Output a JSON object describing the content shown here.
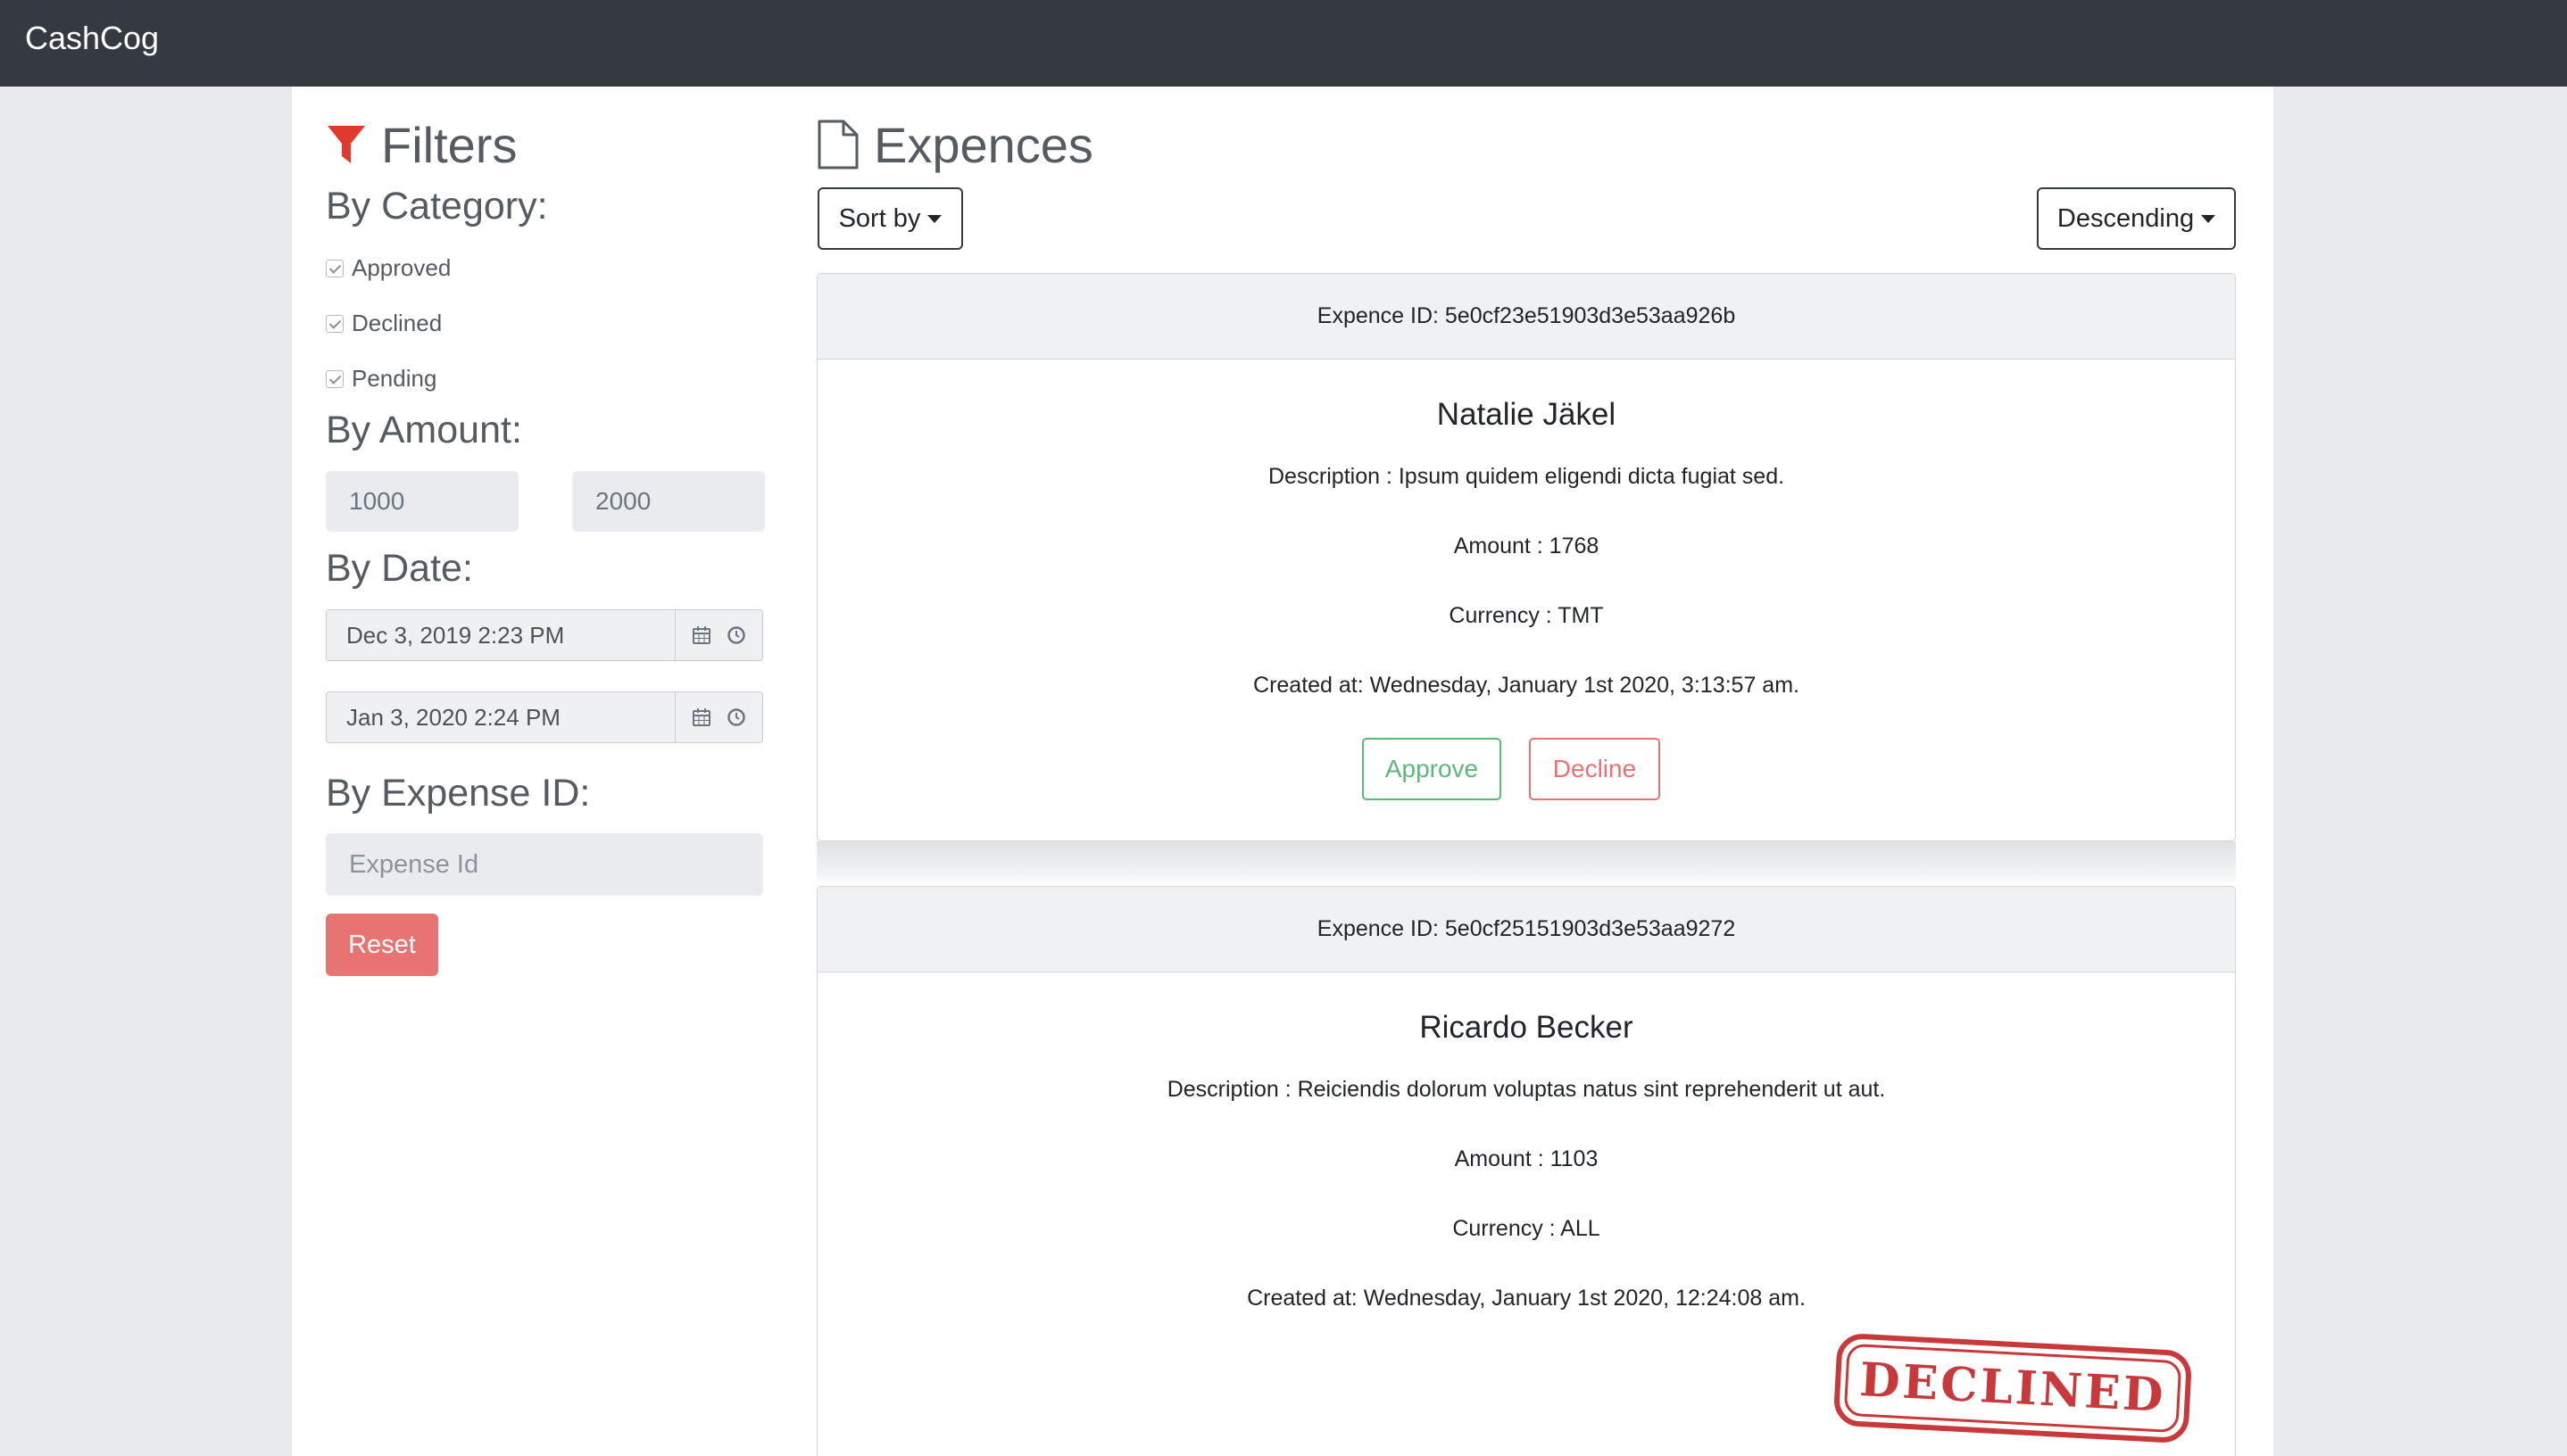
{
  "navbar": {
    "brand": "CashCog"
  },
  "filters": {
    "title": "Filters",
    "by_category": "By Category:",
    "categories": [
      {
        "label": "Approved",
        "checked": true
      },
      {
        "label": "Declined",
        "checked": true
      },
      {
        "label": "Pending",
        "checked": true
      }
    ],
    "by_amount": "By Amount:",
    "amount_min": "1000",
    "amount_max": "2000",
    "by_date": "By Date:",
    "date_from": "Dec 3, 2019 2:23 PM",
    "date_to": "Jan 3, 2020 2:24 PM",
    "by_expense_id": "By Expense ID:",
    "expense_id_placeholder": "Expense Id",
    "reset_label": "Reset"
  },
  "expenses": {
    "title": "Expences",
    "sort_by_label": "Sort by",
    "order_label": "Descending",
    "items": [
      {
        "header": "Expence ID: 5e0cf23e51903d3e53aa926b",
        "name": "Natalie Jäkel",
        "description": "Description : Ipsum quidem eligendi dicta fugiat sed.",
        "amount": "Amount : 1768",
        "currency": "Currency : TMT",
        "created": "Created at: Wednesday, January 1st 2020, 3:13:57 am.",
        "approve_label": "Approve",
        "decline_label": "Decline"
      },
      {
        "header": "Expence ID: 5e0cf25151903d3e53aa9272",
        "name": "Ricardo Becker",
        "description": "Description : Reiciendis dolorum voluptas natus sint reprehenderit ut aut.",
        "amount": "Amount : 1103",
        "currency": "Currency : ALL",
        "created": "Created at: Wednesday, January 1st 2020, 12:24:08 am.",
        "status_stamp": "DECLINED"
      }
    ]
  },
  "colors": {
    "navbar_bg": "#343a40",
    "filter_icon": "#e03a2f",
    "approve": "#5cb87a",
    "decline": "#e57373",
    "stamp": "#c8393b"
  }
}
